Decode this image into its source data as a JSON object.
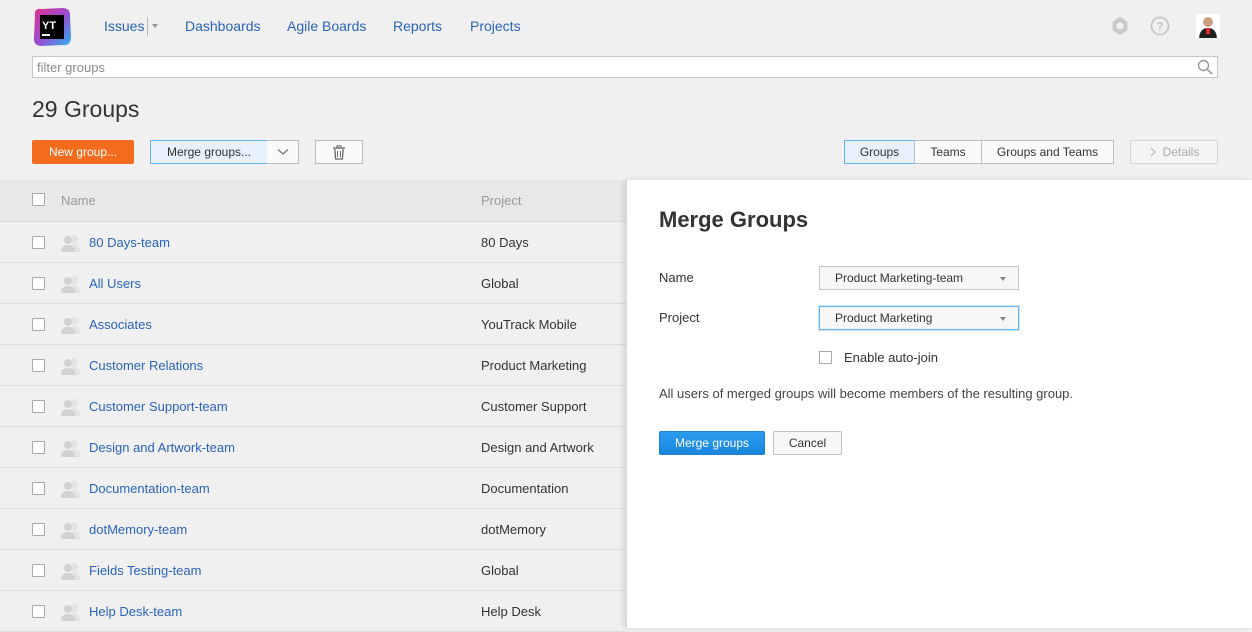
{
  "header": {
    "logo_text": "YT",
    "nav": [
      {
        "label": "Issues"
      },
      {
        "label": "Dashboards"
      },
      {
        "label": "Agile Boards"
      },
      {
        "label": "Reports"
      },
      {
        "label": "Projects"
      }
    ],
    "icons": [
      "settings-icon",
      "help-icon",
      "avatar"
    ]
  },
  "filter": {
    "placeholder": "filter groups",
    "value": ""
  },
  "page": {
    "title": "29 Groups"
  },
  "toolbar": {
    "new_label": "New group...",
    "merge_label": "Merge groups...",
    "views": [
      "Groups",
      "Teams",
      "Groups and Teams"
    ],
    "active_view": "Groups",
    "details_label": "Details"
  },
  "table": {
    "columns": [
      "Name",
      "Project"
    ],
    "rows": [
      {
        "name": "80 Days-team",
        "project": "80 Days"
      },
      {
        "name": "All Users",
        "project": "Global"
      },
      {
        "name": "Associates",
        "project": "YouTrack Mobile"
      },
      {
        "name": "Customer Relations",
        "project": "Product Marketing"
      },
      {
        "name": "Customer Support-team",
        "project": "Customer Support"
      },
      {
        "name": "Design and Artwork-team",
        "project": "Design and Artwork"
      },
      {
        "name": "Documentation-team",
        "project": "Documentation"
      },
      {
        "name": "dotMemory-team",
        "project": "dotMemory"
      },
      {
        "name": "Fields Testing-team",
        "project": "Global"
      },
      {
        "name": "Help Desk-team",
        "project": "Help Desk"
      }
    ]
  },
  "dialog": {
    "title": "Merge Groups",
    "name_label": "Name",
    "name_value": "Product Marketing-team",
    "project_label": "Project",
    "project_value": "Product Marketing",
    "autojoin_label": "Enable auto-join",
    "autojoin_checked": false,
    "note": "All users of merged groups will become members of the resulting group.",
    "submit_label": "Merge groups",
    "cancel_label": "Cancel"
  },
  "colors": {
    "accent": "#f36b1c",
    "link": "#2a64b8",
    "primary": "#1a86de"
  }
}
